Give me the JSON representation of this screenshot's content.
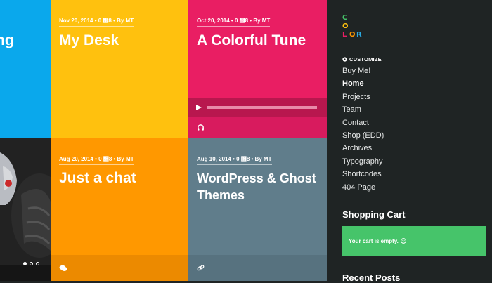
{
  "colors": {
    "blue": "#0aa8ec",
    "yellow": "#ffc10e",
    "pink": "#e91e63",
    "orange": "#ff9800",
    "slate": "#607d8b",
    "sidebar": "#1f2424",
    "cart_green": "#46c46a"
  },
  "posts": [
    {
      "title": "ng",
      "meta": ""
    },
    {
      "title": "My Desk",
      "meta": "Nov 20, 2014 • 0 ὞8 • By MT"
    },
    {
      "title": "A Colorful Tune",
      "meta": "Oct 20, 2014 • 0 ὞8 • By MT",
      "footer_icon": "headphones-icon",
      "player_icon": "play-icon"
    },
    {
      "title": "Just a chat",
      "meta": "Aug 20, 2014 • 0 ὞8 • By MT",
      "footer_icon": "chat-icon"
    },
    {
      "title": "WordPress & Ghost Themes",
      "meta": "Aug 10, 2014 • 0 ὞8 • By MT",
      "footer_icon": "link-icon"
    }
  ],
  "logo": {
    "letters": [
      "C",
      "O",
      "L",
      "O",
      "R"
    ],
    "colors": [
      "#46c46a",
      "#ffc10e",
      "#e91e63",
      "#ff9800",
      "#2aa9e0"
    ]
  },
  "sidebar": {
    "customize_label": "CUSTOMIZE",
    "nav": [
      "Buy Me!",
      "Home",
      "Projects",
      "Team",
      "Contact",
      "Shop (EDD)",
      "Archives",
      "Typography",
      "Shortcodes",
      "404 Page"
    ],
    "active_item": "Home",
    "cart_title": "Shopping Cart",
    "cart_empty": "Your cart is empty.",
    "recent_title": "Recent Posts"
  },
  "slider": {
    "dots": 3,
    "active": 0
  }
}
